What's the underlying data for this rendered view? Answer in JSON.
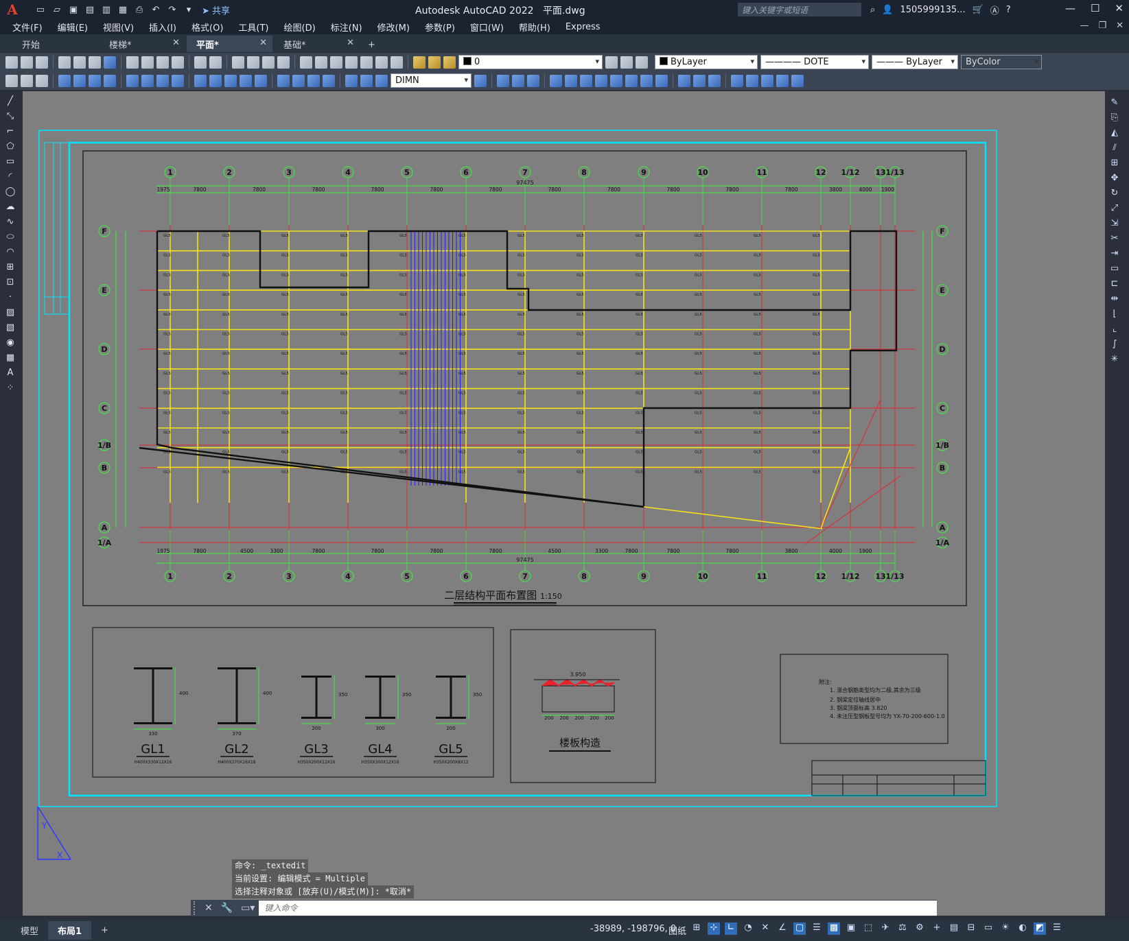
{
  "title": {
    "app_name": "Autodesk AutoCAD 2022",
    "file_name": "平面.dwg",
    "share_label": "共享",
    "search_placeholder": "键入关键字或短语",
    "user_name": "1505999135..."
  },
  "menu": [
    "文件(F)",
    "编辑(E)",
    "视图(V)",
    "插入(I)",
    "格式(O)",
    "工具(T)",
    "绘图(D)",
    "标注(N)",
    "修改(M)",
    "参数(P)",
    "窗口(W)",
    "帮助(H)",
    "Express"
  ],
  "tabs": [
    {
      "label": "开始"
    },
    {
      "label": "楼梯*"
    },
    {
      "label": "平面*"
    },
    {
      "label": "基础*"
    }
  ],
  "toolbar": {
    "layer_value": "0",
    "color_value": "ByLayer",
    "linetype_value": "DOTE",
    "lineweight_value": "ByLayer",
    "plotstyle_value": "ByColor",
    "dimstyle_value": "DIMN"
  },
  "drawing": {
    "main_title": "二层结构平面布置图",
    "main_scale": "1:150",
    "grid_top": [
      "1",
      "2",
      "3",
      "4",
      "5",
      "6",
      "7",
      "8",
      "9",
      "10",
      "11",
      "12",
      "1/12",
      "13",
      "1/13"
    ],
    "grid_rows": [
      "F",
      "E",
      "D",
      "C",
      "1/B",
      "B",
      "A",
      "1/A"
    ],
    "dims_top": [
      "1975",
      "7800",
      "7800",
      "7800",
      "7800",
      "7800",
      "7800",
      "7800",
      "7800",
      "7800",
      "7800",
      "7800",
      "3800",
      "4000",
      "1900"
    ],
    "dims_bottom": [
      "1975",
      "7800",
      "4500",
      "3300",
      "7800",
      "7800",
      "7800",
      "7800",
      "4500",
      "3300",
      "7800",
      "7800",
      "7800",
      "3800",
      "4000",
      "1900"
    ],
    "total_top": "97475",
    "total_bottom": "97475",
    "beam_sections": [
      {
        "name": "GL1",
        "spec": "H400X330X12X16",
        "width": "330",
        "height": "400"
      },
      {
        "name": "GL2",
        "spec": "H400X370X16X18",
        "width": "370",
        "height": "400"
      },
      {
        "name": "GL3",
        "spec": "H350X200X12X16",
        "width": "200",
        "height": "350"
      },
      {
        "name": "GL4",
        "spec": "H350X300X12X16",
        "width": "300",
        "height": "350"
      },
      {
        "name": "GL5",
        "spec": "H350X200X8X12",
        "width": "200",
        "height": "350"
      }
    ],
    "slab_title": "楼板构造",
    "slab_label": "3.950",
    "slab_spacing": [
      "200",
      "200",
      "200",
      "200",
      "200"
    ],
    "notes_title": "附注:",
    "notes": [
      "1. 混合钢筋类型均为二级,其余为三级",
      "2. 钢梁定位轴线居中",
      "3. 钢梁顶面标高 3.820",
      "4. 未注压型钢板型号均为 YX-70-200-600-1.0"
    ]
  },
  "command": {
    "history": [
      "命令: _textedit",
      "当前设置: 编辑模式 = Multiple",
      "选择注释对象或 [放弃(U)/模式(M)]: *取消*"
    ],
    "placeholder": "键入命令"
  },
  "status": {
    "layout_tabs": [
      "模型",
      "布局1"
    ],
    "coords": "-38989, -198796, 0",
    "space": "图纸"
  }
}
